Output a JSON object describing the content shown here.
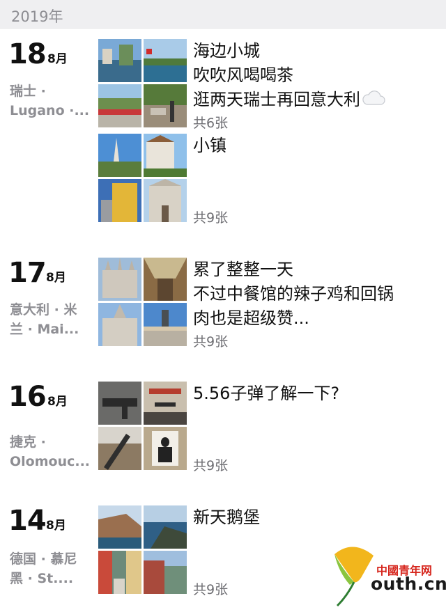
{
  "year": "2019年",
  "entries": [
    {
      "day": "18",
      "month": "8月",
      "location": [
        "瑞士 ·",
        "Lugano ·..."
      ],
      "posts": [
        {
          "lines": [
            "海边小城",
            "吹吹风喝喝茶",
            "逛两天瑞士再回意大利"
          ],
          "icon": "cloud-icon",
          "count": "共6张"
        },
        {
          "lines": [
            "小镇"
          ],
          "count": "共9张"
        }
      ]
    },
    {
      "day": "17",
      "month": "8月",
      "location": [
        "意大利 · 米",
        "兰 · Mai..."
      ],
      "posts": [
        {
          "lines": [
            "累了整整一天",
            "不过中餐馆的辣子鸡和回锅",
            "肉也是超级赞..."
          ],
          "count": "共9张"
        }
      ]
    },
    {
      "day": "16",
      "month": "8月",
      "location": [
        "捷克 ·",
        "Olomouc..."
      ],
      "posts": [
        {
          "lines": [
            "5.56子弹了解一下?"
          ],
          "count": "共9张"
        }
      ]
    },
    {
      "day": "14",
      "month": "8月",
      "location": [
        "德国 · 慕尼",
        "黑 · St...."
      ],
      "posts": [
        {
          "lines": [
            "新天鹅堡"
          ],
          "count": "共9张"
        }
      ]
    }
  ],
  "watermark": {
    "top": "中國青年网",
    "bottom": "outh.cn"
  },
  "colors": {
    "year_bar": "#efeff1",
    "secondary_text": "#8e8e93",
    "watermark_red": "#d6261d",
    "watermark_green": "#8bc53f"
  }
}
